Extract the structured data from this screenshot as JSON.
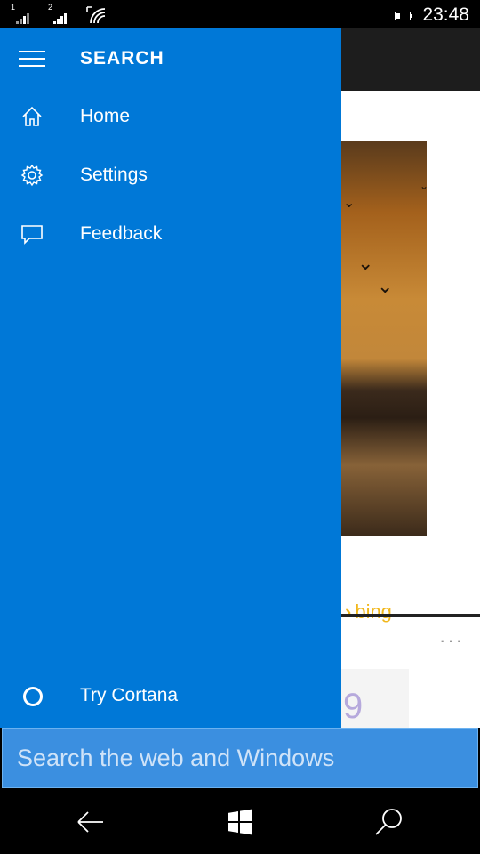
{
  "status_bar": {
    "sim1": "1",
    "sim2": "2",
    "time": "23:48",
    "icons": [
      "signal-sim1-icon",
      "signal-sim2-icon",
      "wifi-icon",
      "battery-icon"
    ]
  },
  "drawer": {
    "title": "SEARCH",
    "items": [
      {
        "label": "Home",
        "icon": "home-icon"
      },
      {
        "label": "Settings",
        "icon": "gear-icon"
      },
      {
        "label": "Feedback",
        "icon": "feedback-icon"
      }
    ],
    "cortana_label": "Try Cortana"
  },
  "background": {
    "bing_label": "bing",
    "thumb_glyph": "9",
    "more": "···"
  },
  "search": {
    "placeholder": "Search the web and Windows",
    "value": ""
  },
  "colors": {
    "accent": "#0078d7",
    "search_field": "#3b8fe0",
    "bing_yellow": "#f1b71b"
  }
}
